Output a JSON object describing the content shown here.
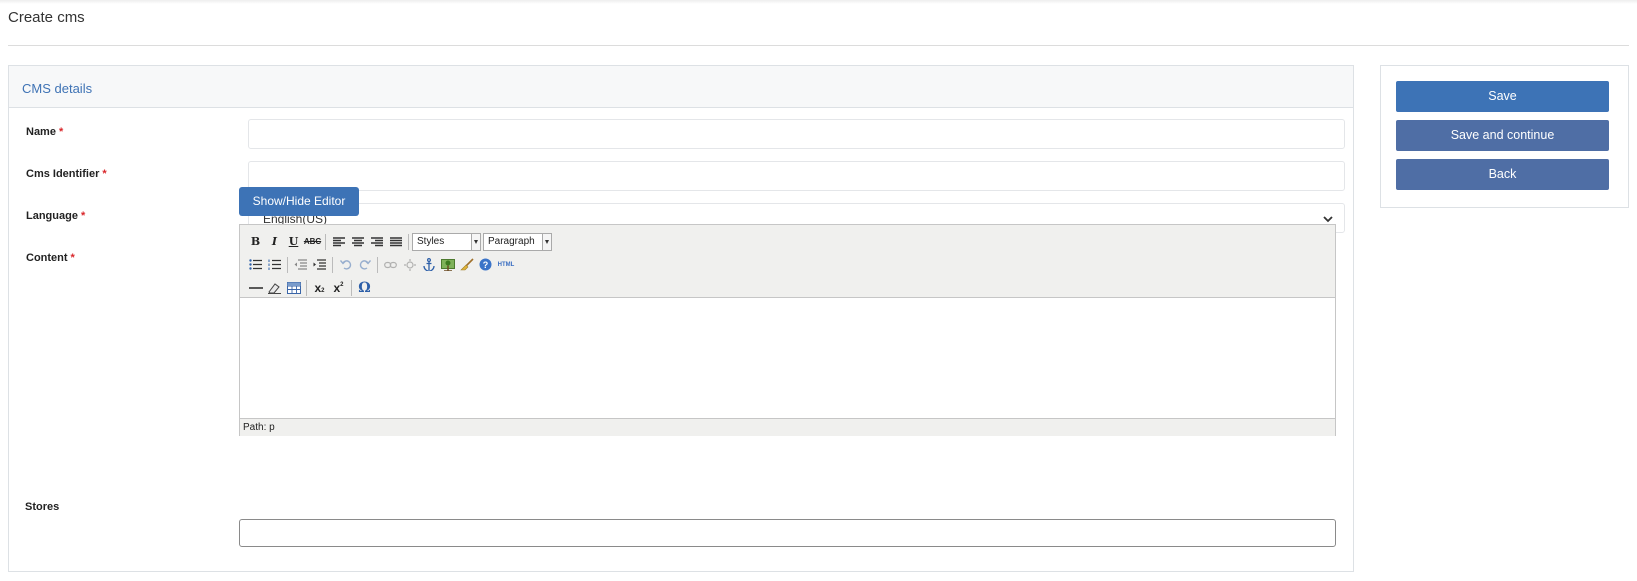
{
  "page": {
    "title": "Create cms"
  },
  "panel": {
    "title": "CMS details"
  },
  "form": {
    "name": {
      "label": "Name",
      "required": "*",
      "value": ""
    },
    "identifier": {
      "label": "Cms Identifier",
      "required": "*",
      "value": ""
    },
    "language": {
      "label": "Language",
      "required": "*",
      "value": "English(US)"
    },
    "content": {
      "label": "Content",
      "required": "*",
      "toggle_label": "Show/Hide Editor"
    },
    "stores": {
      "label": "Stores",
      "value": ""
    }
  },
  "editor": {
    "styles_select": "Styles",
    "format_select": "Paragraph",
    "html_button": "HTML",
    "status_path": "Path: p"
  },
  "actions": {
    "save_label": "Save",
    "save_continue_label": "Save and continue",
    "back_label": "Back"
  },
  "colors": {
    "primary": "#3d73b6",
    "secondary": "#4f6ea5",
    "link": "#3f73b5",
    "required": "#d9262a"
  }
}
